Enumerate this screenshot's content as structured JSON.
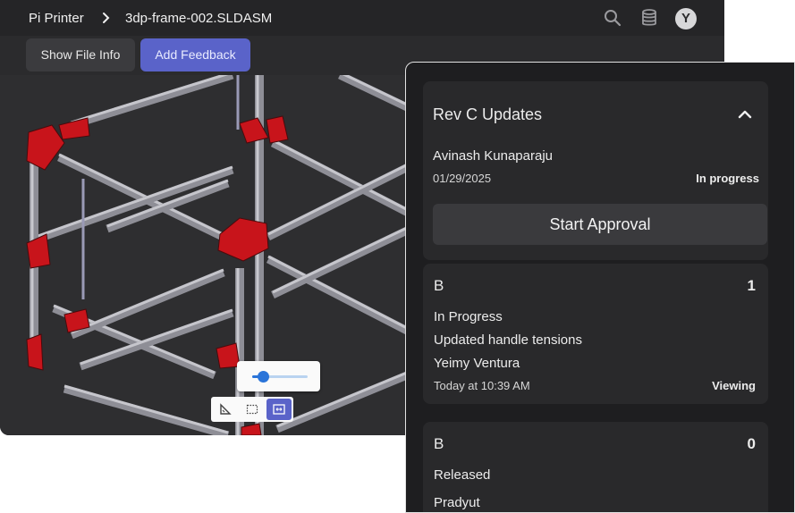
{
  "breadcrumb": {
    "app": "Pi Printer",
    "separator_icon": "chevron-right-icon",
    "file": "3dp-frame-002.SLDASM"
  },
  "topbar_icons": [
    "search-icon",
    "database-icon"
  ],
  "user": {
    "avatar_initial": "Y"
  },
  "toolbar": {
    "show_file_info": "Show File Info",
    "add_feedback": "Add Feedback"
  },
  "viewport": {
    "zoom_slider_value": 0.2,
    "tools": [
      "measure-icon",
      "section-box-icon",
      "fit-view-icon"
    ],
    "active_tool": "fit-view-icon"
  },
  "revision": {
    "title": "Rev C Updates",
    "author": "Avinash Kunaparaju",
    "date": "01/29/2025",
    "status": "In progress",
    "approval_button": "Start Approval",
    "versions": [
      {
        "letter": "B",
        "count": "1",
        "status": "In Progress",
        "note": "Updated handle tensions",
        "author": "Yeimy Ventura",
        "time": "Today at 10:39 AM",
        "tag": "Viewing"
      },
      {
        "letter": "B",
        "count": "0",
        "status": "Released",
        "author": "Pradyut"
      }
    ]
  },
  "colors": {
    "accent": "#5a63c9",
    "slider": "#2a74d9",
    "bracket_red": "#c8141b",
    "extrusion": "#a9a9b0",
    "panel_bg": "#1e1e20",
    "card_bg": "#29292b"
  }
}
